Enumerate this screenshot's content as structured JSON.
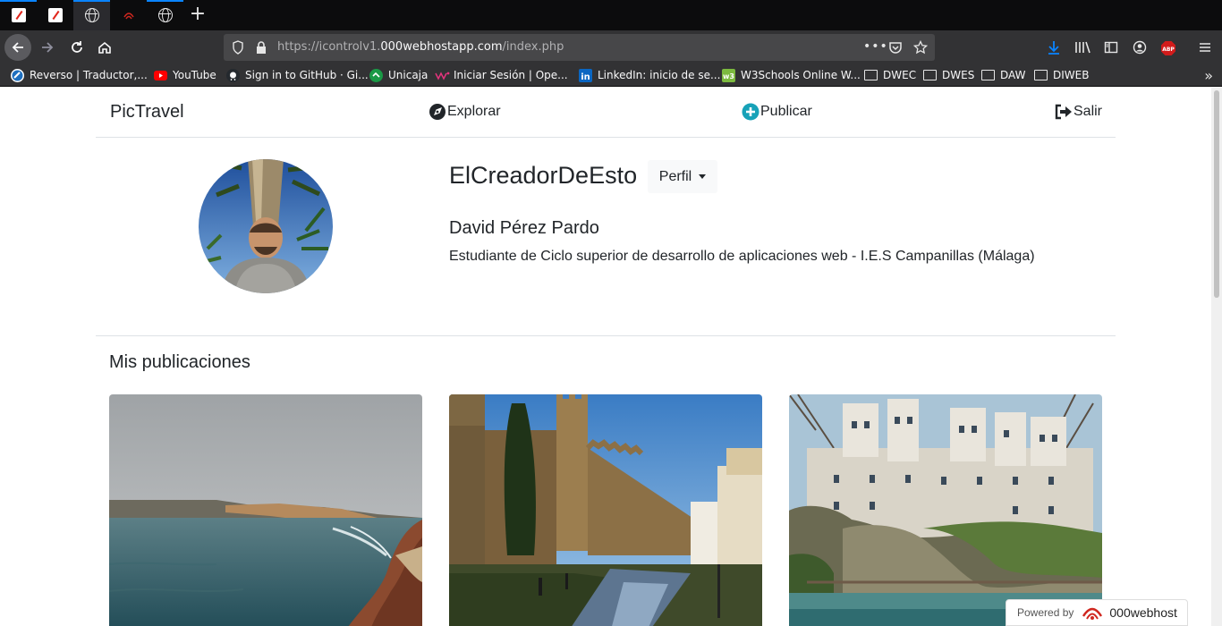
{
  "browser": {
    "url_prefix": "https://icontrolv1.",
    "url_host": "000webhostapp.com",
    "url_path": "/index.php",
    "bookmarks": [
      {
        "label": "Reverso | Traductor,...",
        "icon": "reverso-icon",
        "color": "#e7f1fb"
      },
      {
        "label": "YouTube",
        "icon": "youtube-icon",
        "color": "#ff0000"
      },
      {
        "label": "Sign in to GitHub · Gi...",
        "icon": "github-icon",
        "color": "#f9f9fa"
      },
      {
        "label": "Unicaja",
        "icon": "unicaja-icon",
        "color": "#1a9a46"
      },
      {
        "label": "Iniciar Sesión | Ope...",
        "icon": "openwebinars-icon",
        "color": "#e5347d"
      },
      {
        "label": "LinkedIn: inicio de se...",
        "icon": "linkedin-icon",
        "color": "#0a66c2"
      },
      {
        "label": "W3Schools Online W...",
        "icon": "w3schools-icon",
        "color": "#7cba3f"
      },
      {
        "label": "DWEC",
        "icon": "folder-icon"
      },
      {
        "label": "DWES",
        "icon": "folder-icon"
      },
      {
        "label": "DAW",
        "icon": "folder-icon"
      },
      {
        "label": "DIWEB",
        "icon": "folder-icon"
      }
    ]
  },
  "nav": {
    "brand": "PicTravel",
    "explore": "Explorar",
    "publish": "Publicar",
    "logout": "Salir"
  },
  "profile": {
    "username": "ElCreadorDeEsto",
    "menu_button": "Perfil",
    "full_name": "David Pérez Pardo",
    "bio": "Estudiante de Ciclo superior de desarrollo de aplicaciones web - I.E.S Campanillas (Málaga)"
  },
  "posts": {
    "title": "Mis publicaciones",
    "images": [
      "coastal-cliffs-photo",
      "castle-walls-canal-photo",
      "hanging-houses-cliff-photo"
    ]
  },
  "footer": {
    "powered_by": "Powered by",
    "host_brand": "000webhost"
  },
  "colors": {
    "accent_teal": "#17a2b8",
    "link_blue": "#0a84ff"
  }
}
